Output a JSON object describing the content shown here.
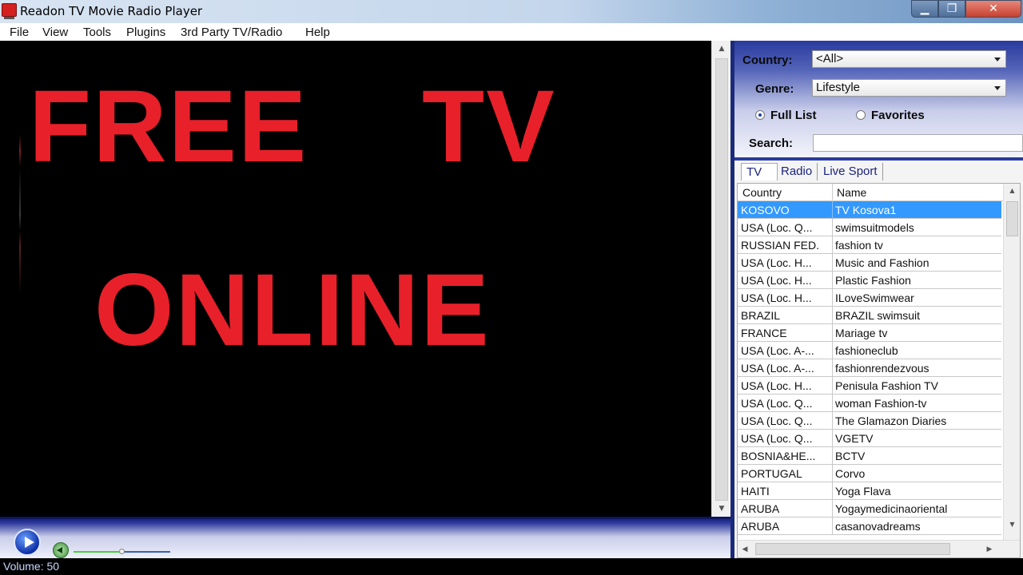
{
  "window": {
    "title": "Readon TV Movie Radio Player"
  },
  "menu": [
    "File",
    "View",
    "Tools",
    "Plugins",
    "3rd Party TV/Radio",
    "Help"
  ],
  "video": {
    "line1_left": "FREE",
    "line1_right": "TV",
    "line2": "ONLINE"
  },
  "filters": {
    "country_label": "Country:",
    "country_value": "<All>",
    "genre_label": "Genre:",
    "genre_value": "Lifestyle",
    "full_list_label": "Full List",
    "favorites_label": "Favorites",
    "search_label": "Search:",
    "search_value": ""
  },
  "tabs": [
    "TV",
    "Radio",
    "Live Sport"
  ],
  "table": {
    "columns": [
      "Country",
      "Name"
    ],
    "rows": [
      [
        "KOSOVO",
        "TV Kosova1"
      ],
      [
        "USA (Loc. Q...",
        "swimsuitmodels"
      ],
      [
        "RUSSIAN FED.",
        "fashion tv"
      ],
      [
        "USA (Loc. H...",
        "Music and Fashion"
      ],
      [
        "USA (Loc. H...",
        "Plastic Fashion"
      ],
      [
        "USA (Loc. H...",
        "ILoveSwimwear"
      ],
      [
        "BRAZIL",
        "BRAZIL swimsuit"
      ],
      [
        "FRANCE",
        "Mariage tv"
      ],
      [
        "USA (Loc. A-...",
        "fashioneclub"
      ],
      [
        "USA (Loc. A-...",
        "fashionrendezvous"
      ],
      [
        "USA (Loc. H...",
        "Penisula Fashion TV"
      ],
      [
        "USA (Loc. Q...",
        "woman Fashion-tv"
      ],
      [
        "USA (Loc. Q...",
        "The Glamazon Diaries"
      ],
      [
        "USA (Loc. Q...",
        "VGETV"
      ],
      [
        "BOSNIA&HE...",
        "BCTV"
      ],
      [
        "PORTUGAL",
        "Corvo"
      ],
      [
        "HAITI",
        "Yoga Flava"
      ],
      [
        "ARUBA",
        "Yogaymedicinaoriental"
      ],
      [
        "ARUBA",
        "casanovadreams"
      ]
    ]
  },
  "player": {
    "volume": 50
  },
  "status": {
    "text": "Volume: 50"
  },
  "colors": {
    "accent_text": "#e8202a",
    "selection": "#3399ff",
    "panel": "#2b3c9c"
  }
}
